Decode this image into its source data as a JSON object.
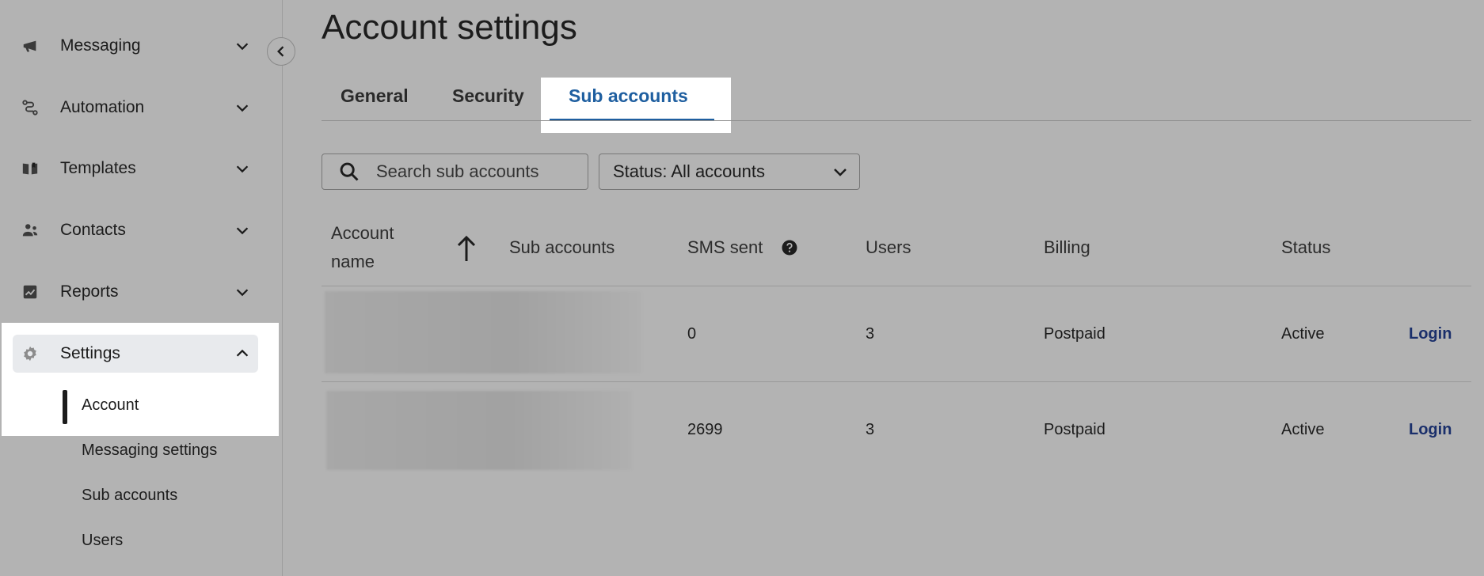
{
  "sidebar": {
    "items": [
      {
        "label": "Messaging",
        "icon": "megaphone-icon"
      },
      {
        "label": "Automation",
        "icon": "automation-icon"
      },
      {
        "label": "Templates",
        "icon": "book-icon"
      },
      {
        "label": "Contacts",
        "icon": "contacts-icon"
      },
      {
        "label": "Reports",
        "icon": "chart-icon"
      },
      {
        "label": "Settings",
        "icon": "gear-icon"
      }
    ],
    "settings_subitems": [
      "Account",
      "Messaging settings",
      "Sub accounts",
      "Users"
    ]
  },
  "page": {
    "title": "Account settings",
    "tabs": [
      "General",
      "Security",
      "Sub accounts"
    ],
    "active_tab": "Sub accounts"
  },
  "filters": {
    "search_placeholder": "Search sub accounts",
    "status_select": "Status: All accounts"
  },
  "table": {
    "headers": {
      "account_name_line1": "Account",
      "account_name_line2": "name",
      "sub_accounts": "Sub accounts",
      "sms_sent": "SMS sent",
      "users": "Users",
      "billing": "Billing",
      "status": "Status"
    },
    "rows": [
      {
        "sms_sent": "0",
        "users": "3",
        "billing": "Postpaid",
        "status": "Active",
        "action": "Login"
      },
      {
        "sms_sent": "2699",
        "users": "3",
        "billing": "Postpaid",
        "status": "Active",
        "action": "Login"
      }
    ]
  },
  "colors": {
    "accent": "#1f5fa0",
    "link": "#1a2f6b",
    "overlay_background": "#b3b3b3"
  }
}
